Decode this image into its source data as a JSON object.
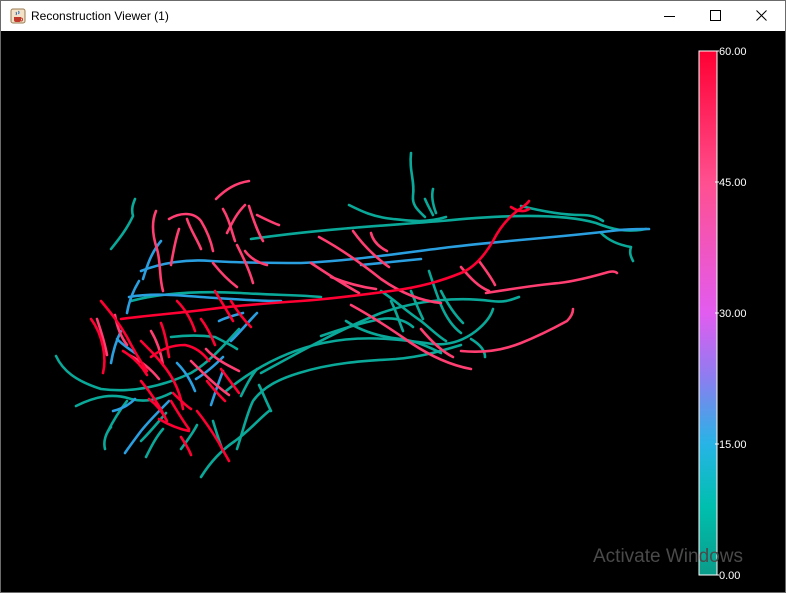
{
  "window": {
    "title": "Reconstruction Viewer (1)",
    "icon": "java-coffee-icon",
    "controls": [
      "minimize-icon",
      "maximize-icon",
      "close-icon"
    ]
  },
  "color_bar": {
    "labels": [
      "60.00",
      "45.00",
      "30.00",
      "15.00",
      "0.00"
    ],
    "min": 0,
    "max": 60,
    "colors": {
      "high": "#ff0033",
      "upper_mid": "#ff4f8f",
      "mid": "#e25cf0",
      "lower_mid": "#6f86ee",
      "low_mid": "#27b4e6",
      "low": "#00bfae",
      "bottom": "#0b9c8a"
    }
  },
  "overlay": {
    "watermark": "Activate Windows"
  },
  "colors": {
    "background": "#000000",
    "teal": "#0aa898",
    "cyan": "#2a9fe0",
    "pink": "#ff3e72",
    "red": "#ff0033"
  }
}
